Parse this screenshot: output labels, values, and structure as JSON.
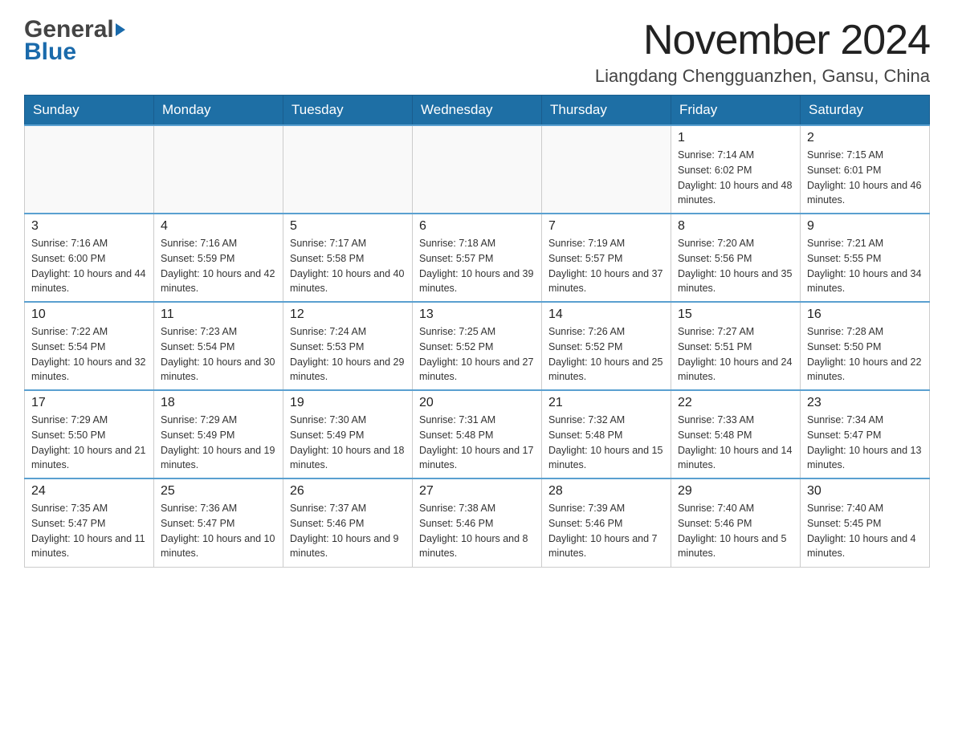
{
  "header": {
    "logo_general": "General",
    "logo_blue": "Blue",
    "month_title": "November 2024",
    "location": "Liangdang Chengguanzhen, Gansu, China"
  },
  "days_of_week": [
    "Sunday",
    "Monday",
    "Tuesday",
    "Wednesday",
    "Thursday",
    "Friday",
    "Saturday"
  ],
  "weeks": [
    [
      {
        "day": "",
        "info": ""
      },
      {
        "day": "",
        "info": ""
      },
      {
        "day": "",
        "info": ""
      },
      {
        "day": "",
        "info": ""
      },
      {
        "day": "",
        "info": ""
      },
      {
        "day": "1",
        "info": "Sunrise: 7:14 AM\nSunset: 6:02 PM\nDaylight: 10 hours and 48 minutes."
      },
      {
        "day": "2",
        "info": "Sunrise: 7:15 AM\nSunset: 6:01 PM\nDaylight: 10 hours and 46 minutes."
      }
    ],
    [
      {
        "day": "3",
        "info": "Sunrise: 7:16 AM\nSunset: 6:00 PM\nDaylight: 10 hours and 44 minutes."
      },
      {
        "day": "4",
        "info": "Sunrise: 7:16 AM\nSunset: 5:59 PM\nDaylight: 10 hours and 42 minutes."
      },
      {
        "day": "5",
        "info": "Sunrise: 7:17 AM\nSunset: 5:58 PM\nDaylight: 10 hours and 40 minutes."
      },
      {
        "day": "6",
        "info": "Sunrise: 7:18 AM\nSunset: 5:57 PM\nDaylight: 10 hours and 39 minutes."
      },
      {
        "day": "7",
        "info": "Sunrise: 7:19 AM\nSunset: 5:57 PM\nDaylight: 10 hours and 37 minutes."
      },
      {
        "day": "8",
        "info": "Sunrise: 7:20 AM\nSunset: 5:56 PM\nDaylight: 10 hours and 35 minutes."
      },
      {
        "day": "9",
        "info": "Sunrise: 7:21 AM\nSunset: 5:55 PM\nDaylight: 10 hours and 34 minutes."
      }
    ],
    [
      {
        "day": "10",
        "info": "Sunrise: 7:22 AM\nSunset: 5:54 PM\nDaylight: 10 hours and 32 minutes."
      },
      {
        "day": "11",
        "info": "Sunrise: 7:23 AM\nSunset: 5:54 PM\nDaylight: 10 hours and 30 minutes."
      },
      {
        "day": "12",
        "info": "Sunrise: 7:24 AM\nSunset: 5:53 PM\nDaylight: 10 hours and 29 minutes."
      },
      {
        "day": "13",
        "info": "Sunrise: 7:25 AM\nSunset: 5:52 PM\nDaylight: 10 hours and 27 minutes."
      },
      {
        "day": "14",
        "info": "Sunrise: 7:26 AM\nSunset: 5:52 PM\nDaylight: 10 hours and 25 minutes."
      },
      {
        "day": "15",
        "info": "Sunrise: 7:27 AM\nSunset: 5:51 PM\nDaylight: 10 hours and 24 minutes."
      },
      {
        "day": "16",
        "info": "Sunrise: 7:28 AM\nSunset: 5:50 PM\nDaylight: 10 hours and 22 minutes."
      }
    ],
    [
      {
        "day": "17",
        "info": "Sunrise: 7:29 AM\nSunset: 5:50 PM\nDaylight: 10 hours and 21 minutes."
      },
      {
        "day": "18",
        "info": "Sunrise: 7:29 AM\nSunset: 5:49 PM\nDaylight: 10 hours and 19 minutes."
      },
      {
        "day": "19",
        "info": "Sunrise: 7:30 AM\nSunset: 5:49 PM\nDaylight: 10 hours and 18 minutes."
      },
      {
        "day": "20",
        "info": "Sunrise: 7:31 AM\nSunset: 5:48 PM\nDaylight: 10 hours and 17 minutes."
      },
      {
        "day": "21",
        "info": "Sunrise: 7:32 AM\nSunset: 5:48 PM\nDaylight: 10 hours and 15 minutes."
      },
      {
        "day": "22",
        "info": "Sunrise: 7:33 AM\nSunset: 5:48 PM\nDaylight: 10 hours and 14 minutes."
      },
      {
        "day": "23",
        "info": "Sunrise: 7:34 AM\nSunset: 5:47 PM\nDaylight: 10 hours and 13 minutes."
      }
    ],
    [
      {
        "day": "24",
        "info": "Sunrise: 7:35 AM\nSunset: 5:47 PM\nDaylight: 10 hours and 11 minutes."
      },
      {
        "day": "25",
        "info": "Sunrise: 7:36 AM\nSunset: 5:47 PM\nDaylight: 10 hours and 10 minutes."
      },
      {
        "day": "26",
        "info": "Sunrise: 7:37 AM\nSunset: 5:46 PM\nDaylight: 10 hours and 9 minutes."
      },
      {
        "day": "27",
        "info": "Sunrise: 7:38 AM\nSunset: 5:46 PM\nDaylight: 10 hours and 8 minutes."
      },
      {
        "day": "28",
        "info": "Sunrise: 7:39 AM\nSunset: 5:46 PM\nDaylight: 10 hours and 7 minutes."
      },
      {
        "day": "29",
        "info": "Sunrise: 7:40 AM\nSunset: 5:46 PM\nDaylight: 10 hours and 5 minutes."
      },
      {
        "day": "30",
        "info": "Sunrise: 7:40 AM\nSunset: 5:45 PM\nDaylight: 10 hours and 4 minutes."
      }
    ]
  ]
}
